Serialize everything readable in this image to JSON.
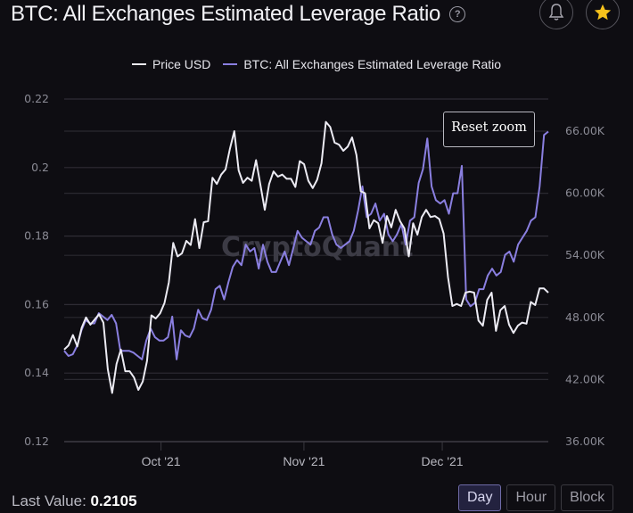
{
  "header": {
    "title": "BTC: All Exchanges Estimated Leverage Ratio",
    "help_icon": "question-circle-icon",
    "alert_icon": "bell-icon",
    "favorite_icon": "star-icon"
  },
  "colors": {
    "background": "#0e0d12",
    "price_line": "#ecebf3",
    "leverage_line": "#8a7fe0",
    "star": "#f6c21c",
    "grid": "#2e2d35"
  },
  "legend": [
    {
      "label": "Price USD",
      "color": "#ecebf3"
    },
    {
      "label": "BTC: All Exchanges Estimated Leverage Ratio",
      "color": "#8a7fe0"
    }
  ],
  "watermark": "CryptoQuant",
  "reset_zoom_label": "Reset zoom",
  "footer": {
    "last_value_label": "Last Value:",
    "last_value": "0.2105",
    "interval_buttons": [
      {
        "label": "Day",
        "active": true
      },
      {
        "label": "Hour",
        "active": false
      },
      {
        "label": "Block",
        "active": false
      }
    ]
  },
  "chart_data": {
    "type": "line",
    "title": "BTC: All Exchanges Estimated Leverage Ratio",
    "x_start": "2021-09-10",
    "x_end": "2021-12-24",
    "x_ticks": [
      "Oct '21",
      "Nov '21",
      "Dec '21"
    ],
    "x_tick_dates": [
      "2021-10-01",
      "2021-11-01",
      "2021-12-01"
    ],
    "left_axis": {
      "ticks": [
        "0.12",
        "0.14",
        "0.16",
        "0.18",
        "0.2",
        "0.22"
      ],
      "range": [
        0.12,
        0.22
      ]
    },
    "right_axis": {
      "ticks": [
        "36.00K",
        "42.00K",
        "48.00K",
        "54.00K",
        "60.00K",
        "66.00K"
      ],
      "range": [
        36000,
        66000
      ]
    },
    "grid": true,
    "legend_position": "top-center",
    "series": [
      {
        "name": "Price USD",
        "axis": "right",
        "values": [
          44900,
          45300,
          46300,
          45200,
          47000,
          48000,
          47300,
          47800,
          48300,
          47500,
          43000,
          40700,
          43500,
          44900,
          42800,
          42800,
          42200,
          41000,
          41800,
          43800,
          48200,
          47900,
          48400,
          49400,
          51400,
          55200,
          53900,
          54200,
          55400,
          55000,
          57500,
          54700,
          57200,
          57300,
          61500,
          60900,
          61800,
          62300,
          64300,
          66000,
          62200,
          61000,
          61500,
          61200,
          63200,
          60800,
          58400,
          60900,
          62100,
          61600,
          61800,
          61400,
          61400,
          60600,
          63100,
          62800,
          61200,
          60500,
          61300,
          62900,
          66900,
          66400,
          64900,
          64700,
          64100,
          64500,
          65400,
          63700,
          60200,
          60000,
          56600,
          57400,
          57100,
          55200,
          57800,
          56700,
          58400,
          57300,
          56600,
          53900,
          57100,
          56000,
          57700,
          58400,
          57700,
          57800,
          57500,
          56100,
          51900,
          49100,
          49300,
          49100,
          50400,
          50500,
          50400,
          47700,
          47200,
          49700,
          50400,
          46700,
          48700,
          49100,
          47300,
          46500,
          47200,
          47500,
          47400,
          49500,
          49200,
          50800,
          50800,
          50400
        ]
      },
      {
        "name": "BTC: All Exchanges Estimated Leverage Ratio",
        "axis": "left",
        "values": [
          0.1465,
          0.145,
          0.1455,
          0.148,
          0.1525,
          0.1555,
          0.1545,
          0.1545,
          0.1575,
          0.1565,
          0.1555,
          0.157,
          0.1545,
          0.1465,
          0.1465,
          0.1465,
          0.146,
          0.145,
          0.144,
          0.1495,
          0.153,
          0.1505,
          0.1495,
          0.1495,
          0.1505,
          0.1565,
          0.144,
          0.1525,
          0.151,
          0.1505,
          0.153,
          0.1585,
          0.156,
          0.1555,
          0.1585,
          0.1645,
          0.1655,
          0.1615,
          0.1665,
          0.171,
          0.173,
          0.1715,
          0.1775,
          0.1755,
          0.1765,
          0.1705,
          0.1775,
          0.1725,
          0.1695,
          0.1695,
          0.1725,
          0.1755,
          0.1715,
          0.1765,
          0.1815,
          0.1795,
          0.1785,
          0.1775,
          0.1815,
          0.1825,
          0.1855,
          0.1855,
          0.1805,
          0.1775,
          0.1765,
          0.1775,
          0.1785,
          0.1815,
          0.1875,
          0.1945,
          0.1855,
          0.1865,
          0.1895,
          0.1845,
          0.1865,
          0.1805,
          0.1785,
          0.1805,
          0.1835,
          0.1775,
          0.1845,
          0.1855,
          0.1955,
          0.1995,
          0.2085,
          0.1945,
          0.1905,
          0.1895,
          0.1905,
          0.1865,
          0.1925,
          0.1925,
          0.2005,
          0.1615,
          0.1595,
          0.1605,
          0.1645,
          0.1645,
          0.1685,
          0.1705,
          0.1685,
          0.1695,
          0.1745,
          0.1755,
          0.1725,
          0.1775,
          0.1795,
          0.1815,
          0.1845,
          0.1855,
          0.1945,
          0.2095,
          0.2105
        ]
      }
    ]
  }
}
